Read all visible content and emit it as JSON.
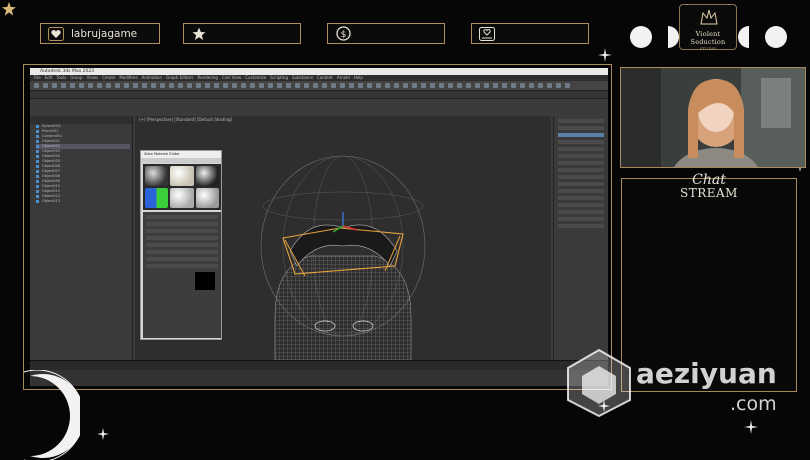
{
  "social": {
    "twitch_user": "labrujagame",
    "icons": [
      "heart-icon",
      "star-icon",
      "dollar-icon",
      "hand-heart-icon"
    ]
  },
  "brand": {
    "logo_line1": "Violent Seduction",
    "logo_line2": "STUDIO"
  },
  "app": {
    "window_title": "Autodesk 3ds Max 2023",
    "menu": [
      "File",
      "Edit",
      "Tools",
      "Group",
      "Views",
      "Create",
      "Modifiers",
      "Animation",
      "Graph Editors",
      "Rendering",
      "Civil View",
      "Customize",
      "Scripting",
      "Substance",
      "Content",
      "Arnold",
      "Help"
    ],
    "viewport_label": "[+] [Perspective] [Standard] [Default Shading]",
    "material_editor_title": "Slate Material Editor",
    "material_menu": [
      "Modes",
      "Material",
      "Navigation",
      "Options",
      "Utilities"
    ],
    "scene_items": [
      "Sphere001",
      "Plane001",
      "Camera001",
      "Object001",
      "Object002",
      "Object003",
      "Object004",
      "Object005",
      "Object006",
      "Object007",
      "Object008",
      "Object009",
      "Object010",
      "Object011",
      "Object012",
      "Object013"
    ],
    "colors": {
      "accent": "#a8895b",
      "wire": "#c9c9c9",
      "selection": "#e8a33b"
    }
  },
  "chat": {
    "title_script": "Chat",
    "title_caps": "STREAM"
  },
  "watermark": {
    "text": "aeziyuan",
    "domain": ".com"
  }
}
